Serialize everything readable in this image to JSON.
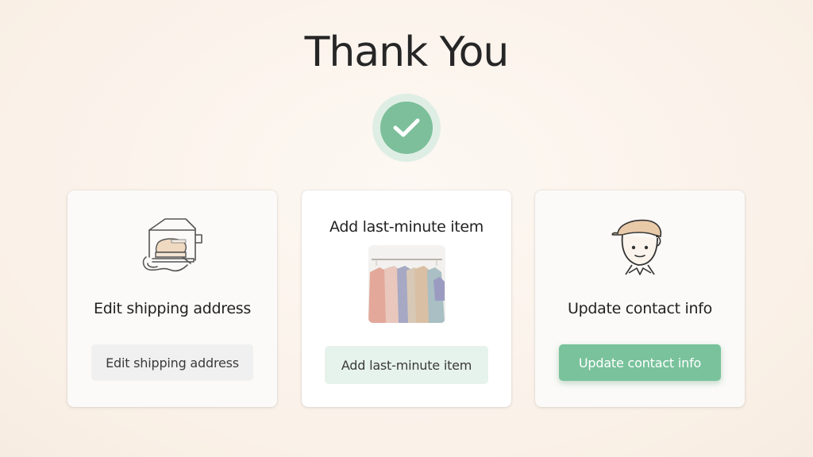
{
  "page": {
    "title": "Thank You"
  },
  "cards": [
    {
      "heading": "Edit shipping address",
      "button_label": "Edit shipping address",
      "icon": "package-icon"
    },
    {
      "heading": "Add last-minute item",
      "button_label": "Add last-minute item",
      "image": "clothing-rack-photo"
    },
    {
      "heading": "Update contact info",
      "button_label": "Update contact info",
      "icon": "person-avatar-icon"
    }
  ],
  "colors": {
    "accent_green": "#79c29c",
    "check_ring": "#dfeee4",
    "mint_button": "#e6f3ec",
    "gray_button": "#f0f0f1",
    "background": "#faf1e8"
  }
}
